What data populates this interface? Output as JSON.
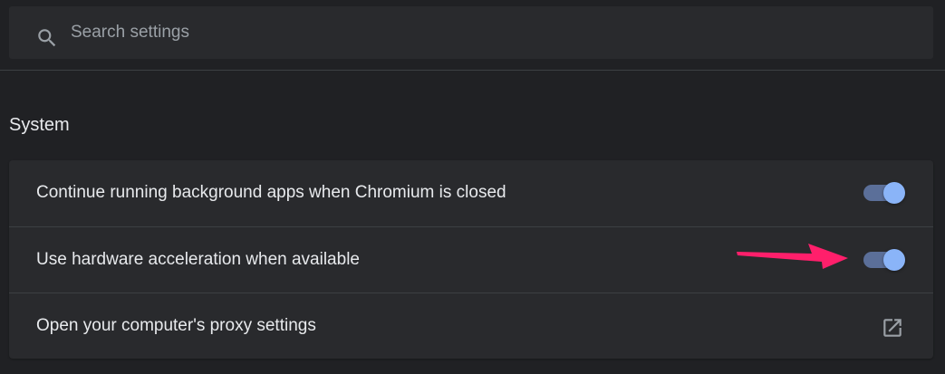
{
  "search": {
    "placeholder": "Search settings",
    "value": ""
  },
  "section": {
    "title": "System"
  },
  "settings": [
    {
      "label": "Continue running background apps when Chromium is closed",
      "control": "toggle",
      "checked": true
    },
    {
      "label": "Use hardware acceleration when available",
      "control": "toggle",
      "checked": true
    },
    {
      "label": "Open your computer's proxy settings",
      "control": "external-link"
    }
  ],
  "icons": {
    "search": "search-icon",
    "external": "open-in-new-icon",
    "annotation": "annotation-arrow-icon"
  },
  "colors": {
    "background": "#202124",
    "card": "#292a2d",
    "text": "#e8eaed",
    "placeholder": "#9aa0a6",
    "toggle_track": "#5b6f99",
    "toggle_knob": "#8ab4f8",
    "annotation_arrow": "#ff1f6b"
  }
}
